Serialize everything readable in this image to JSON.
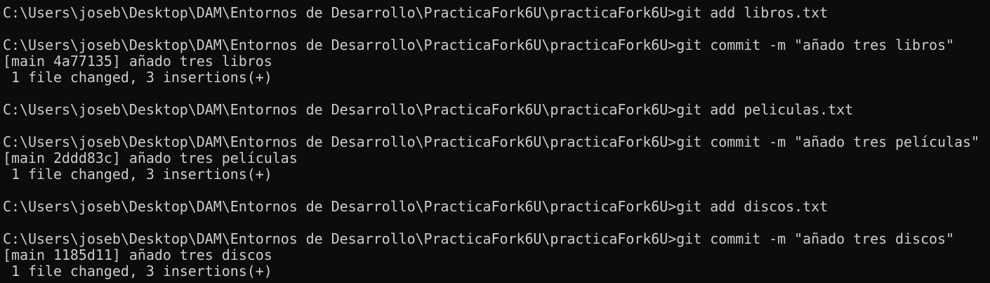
{
  "terminal": {
    "lines": [
      "C:\\Users\\joseb\\Desktop\\DAM\\Entornos de Desarrollo\\PracticaFork6U\\practicaFork6U>git add libros.txt",
      "",
      "C:\\Users\\joseb\\Desktop\\DAM\\Entornos de Desarrollo\\PracticaFork6U\\practicaFork6U>git commit -m \"añado tres libros\"",
      "[main 4a77135] añado tres libros",
      " 1 file changed, 3 insertions(+)",
      "",
      "C:\\Users\\joseb\\Desktop\\DAM\\Entornos de Desarrollo\\PracticaFork6U\\practicaFork6U>git add peliculas.txt",
      "",
      "C:\\Users\\joseb\\Desktop\\DAM\\Entornos de Desarrollo\\PracticaFork6U\\practicaFork6U>git commit -m \"añado tres películas\"",
      "[main 2ddd83c] añado tres películas",
      " 1 file changed, 3 insertions(+)",
      "",
      "C:\\Users\\joseb\\Desktop\\DAM\\Entornos de Desarrollo\\PracticaFork6U\\practicaFork6U>git add discos.txt",
      "",
      "C:\\Users\\joseb\\Desktop\\DAM\\Entornos de Desarrollo\\PracticaFork6U\\practicaFork6U>git commit -m \"añado tres discos\"",
      "[main 1185d11] añado tres discos",
      " 1 file changed, 3 insertions(+)"
    ]
  },
  "colors": {
    "background": "#0c0c0c",
    "foreground": "#cccccc"
  }
}
